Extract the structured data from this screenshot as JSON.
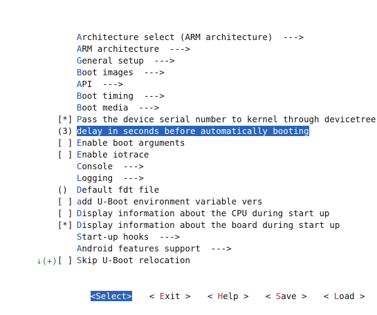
{
  "menu": {
    "items": [
      {
        "prefix": "",
        "hot": "A",
        "rest": "rchitecture select (ARM architecture)  --->",
        "selected": false
      },
      {
        "prefix": "",
        "hot": "A",
        "rest": "RM architecture  --->",
        "selected": false
      },
      {
        "prefix": "",
        "hot": "G",
        "rest": "eneral setup  --->",
        "selected": false
      },
      {
        "prefix": "",
        "hot": "B",
        "rest": "oot images  --->",
        "selected": false
      },
      {
        "prefix": "",
        "hot": "A",
        "rest": "PI  --->",
        "selected": false
      },
      {
        "prefix": "",
        "hot": "B",
        "rest": "oot timing  --->",
        "selected": false
      },
      {
        "prefix": "",
        "hot": "B",
        "rest": "oot media  --->",
        "selected": false
      },
      {
        "prefix": "[*]",
        "hot": "P",
        "rest": "ass the device serial number to kernel through devicetree",
        "selected": false
      },
      {
        "prefix": "(3)",
        "hot": "d",
        "rest": "elay in seconds before automatically booting",
        "selected": true
      },
      {
        "prefix": "[ ]",
        "hot": "E",
        "rest": "nable boot arguments",
        "selected": false
      },
      {
        "prefix": "[ ]",
        "hot": "E",
        "rest": "nable iotrace",
        "selected": false
      },
      {
        "prefix": "",
        "hot": "C",
        "rest": "onsole  --->",
        "selected": false
      },
      {
        "prefix": "",
        "hot": "L",
        "rest": "ogging  --->",
        "selected": false
      },
      {
        "prefix": "()",
        "hot": "D",
        "rest": "efault fdt file",
        "selected": false
      },
      {
        "prefix": "[ ]",
        "hot": "a",
        "rest": "dd U-Boot environment variable vers",
        "selected": false
      },
      {
        "prefix": "[ ]",
        "hot": "D",
        "rest": "isplay information about the CPU during start up",
        "selected": false
      },
      {
        "prefix": "[*]",
        "hot": "D",
        "rest": "isplay information about the board during start up",
        "selected": false
      },
      {
        "prefix": "",
        "hot": "S",
        "rest": "tart-up hooks  --->",
        "selected": false
      },
      {
        "prefix": "",
        "hot": "A",
        "rest": "ndroid features support  --->",
        "selected": false
      },
      {
        "prefix": "[ ]",
        "hot": "S",
        "rest": "kip U-Boot relocation",
        "selected": false
      }
    ],
    "more_indicator": "↓(+)"
  },
  "buttons": {
    "select": {
      "open": "<",
      "hot": "S",
      "rest": "elect",
      "close": ">"
    },
    "exit": {
      "open": "< ",
      "hot": "E",
      "rest": "xit",
      "close": " >"
    },
    "help": {
      "open": "< ",
      "hot": "H",
      "rest": "elp",
      "close": " >"
    },
    "save": {
      "open": "< ",
      "hot": "S",
      "rest": "ave",
      "close": " >"
    },
    "load": {
      "open": "< ",
      "hot": "L",
      "rest": "oad",
      "close": " >"
    }
  },
  "colors": {
    "highlight": "#2b63b8",
    "hotkey": "#1a56b0",
    "button_hotkey": "#b23030",
    "more_indicator": "#2a8a2a"
  }
}
